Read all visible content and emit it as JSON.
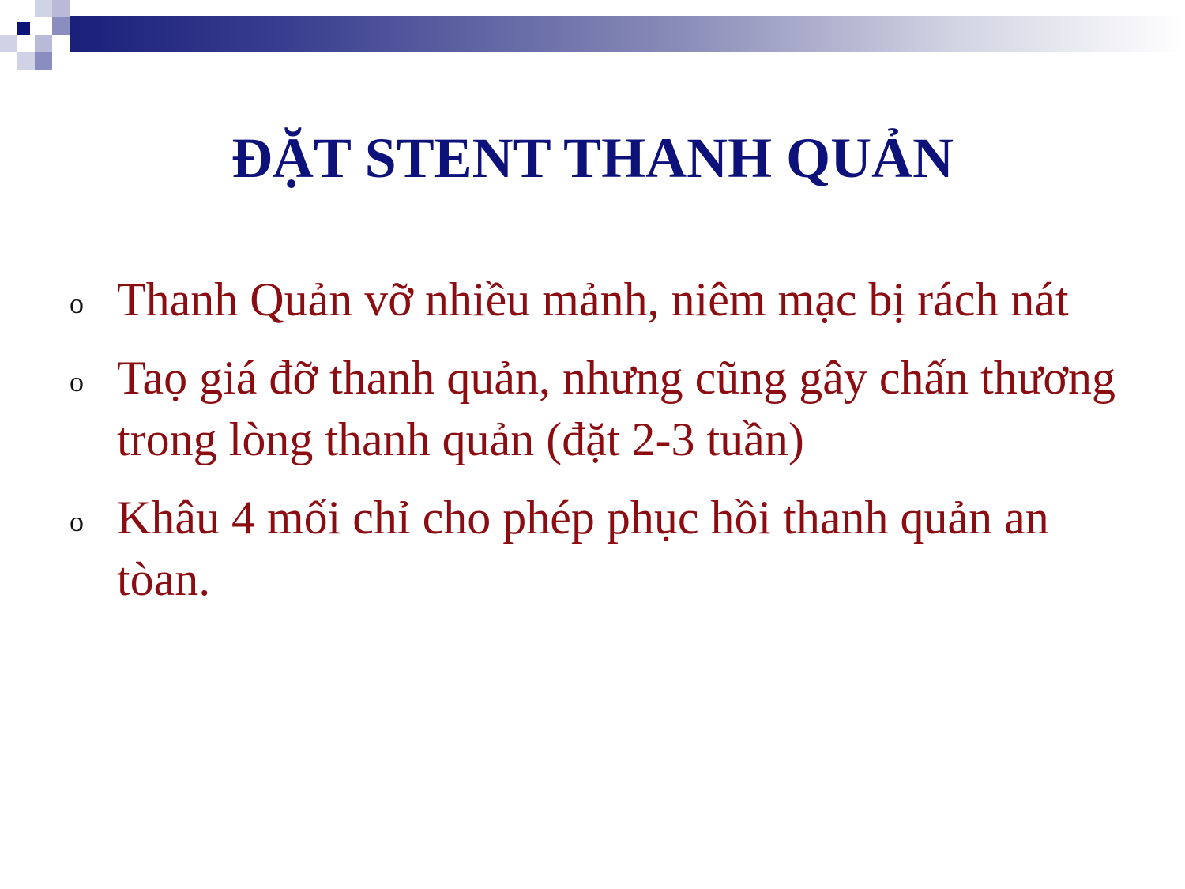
{
  "slide": {
    "title": "ĐẶT STENT THANH QUẢN",
    "bullet_marker": "o",
    "bullets": [
      {
        "text": "Thanh Quản vỡ nhiều mảnh, niêm mạc bị rách nát"
      },
      {
        "text": "Taọ giá đỡ thanh quản, nhưng cũng gây chấn thương trong lòng thanh quản (đặt 2-3 tuần)"
      },
      {
        "text": "Khâu 4 mối chỉ cho phép phục hồi thanh quản an tòan."
      }
    ]
  },
  "colors": {
    "title": "#0d117a",
    "body_text": "#8b0d12",
    "bar_start": "#1a1f7a",
    "decor_squares": [
      "#0d117a",
      "#5b5fa8",
      "#b8bad8"
    ]
  }
}
